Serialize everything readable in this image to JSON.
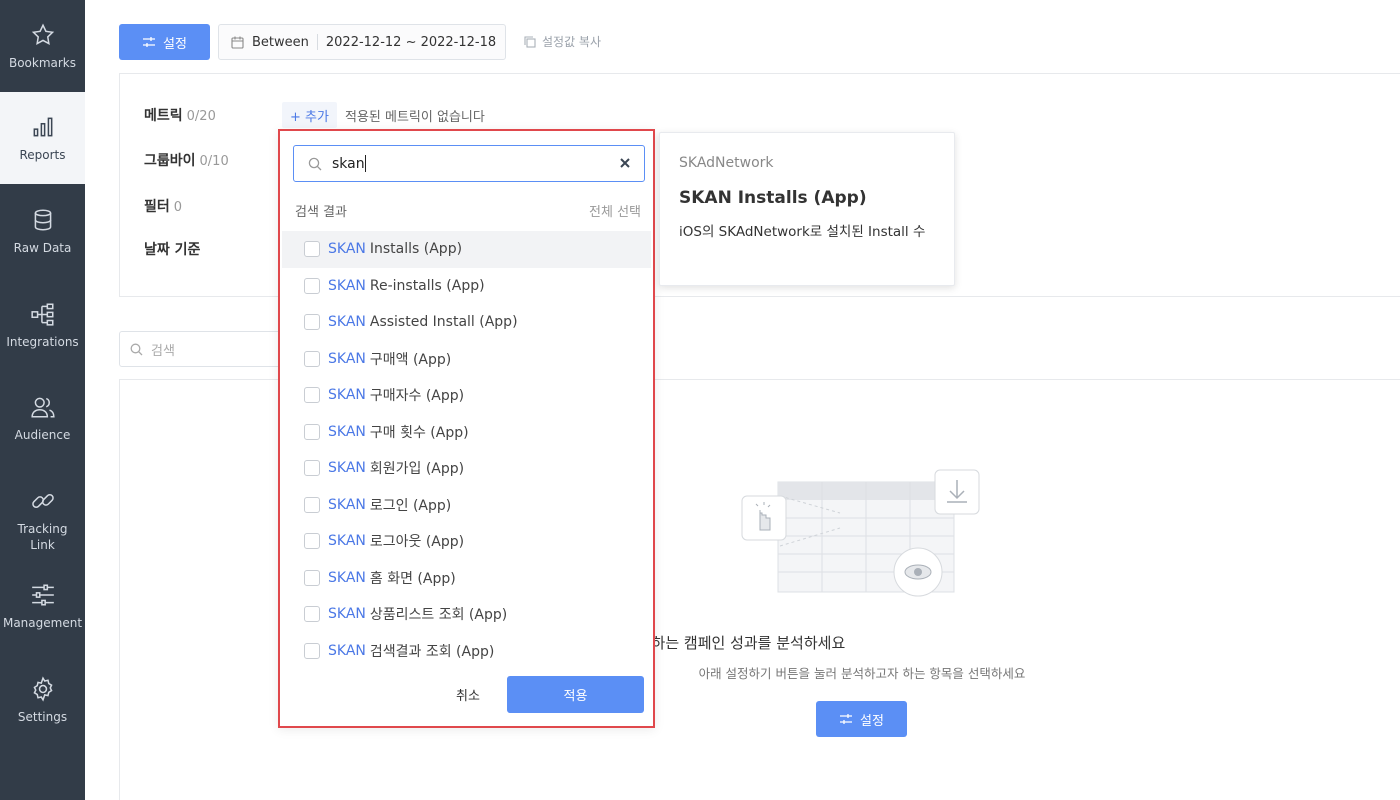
{
  "sidebar": {
    "items": [
      {
        "label": "Bookmarks",
        "icon": "star-icon"
      },
      {
        "label": "Reports",
        "icon": "bar-chart-icon",
        "active": true
      },
      {
        "label": "Raw Data",
        "icon": "database-icon"
      },
      {
        "label": "Integrations",
        "icon": "network-icon"
      },
      {
        "label": "Audience",
        "icon": "users-icon"
      },
      {
        "label": "Tracking Link",
        "icon": "link-icon"
      },
      {
        "label": "Management",
        "icon": "sliders-icon"
      },
      {
        "label": "Settings",
        "icon": "gear-icon"
      }
    ]
  },
  "toolbar": {
    "setting_label": "설정",
    "date_mode": "Between",
    "date_range": "2022-12-12 ~ 2022-12-18",
    "copy_label": "설정값 복사"
  },
  "settings": {
    "metric_label": "메트릭",
    "metric_count": "0/20",
    "groupby_label": "그룹바이",
    "groupby_count": "0/10",
    "filter_label": "필터",
    "filter_count": "0",
    "date_basis_label": "날짜 기준",
    "add_label": "+ 추가",
    "no_metric_text": "적용된 메트릭이 없습니다"
  },
  "bg_search": {
    "placeholder": "검색"
  },
  "dropdown": {
    "search_value": "skan",
    "results_label": "검색 결과",
    "select_all_label": "전체 선택",
    "highlight": "SKAN",
    "items": [
      {
        "rest": "Installs (App)"
      },
      {
        "rest": "Re-installs (App)"
      },
      {
        "rest": "Assisted Install (App)"
      },
      {
        "rest": "구매액 (App)"
      },
      {
        "rest": "구매자수 (App)"
      },
      {
        "rest": "구매 횟수 (App)"
      },
      {
        "rest": "회원가입 (App)"
      },
      {
        "rest": "로그인 (App)"
      },
      {
        "rest": "로그아웃 (App)"
      },
      {
        "rest": "홈 화면 (App)"
      },
      {
        "rest": "상품리스트 조회 (App)"
      },
      {
        "rest": "검색결과 조회 (App)"
      }
    ],
    "cancel_label": "취소",
    "apply_label": "적용"
  },
  "info_card": {
    "category": "SKAdNetwork",
    "title": "SKAN Installs (App)",
    "description": "iOS의 SKAdNetwork로 설치된 Install 수"
  },
  "empty_state": {
    "title": "원하는 캠페인 성과를 분석하세요",
    "description": "아래 설정하기 버튼을 눌러 분석하고자 하는 항목을 선택하세요",
    "button_label": "설정"
  },
  "colors": {
    "sidebar_bg": "#323c48",
    "primary": "#5b8ff5",
    "highlight": "#4b78e6",
    "annotation_border": "#e0484c"
  }
}
